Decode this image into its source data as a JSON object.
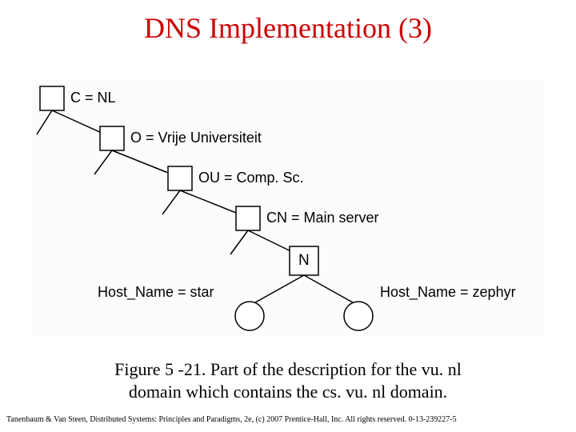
{
  "title": "DNS Implementation (3)",
  "diagram": {
    "nodes": {
      "c": {
        "label": "C = NL"
      },
      "o": {
        "label": "O = Vrije Universiteit"
      },
      "ou": {
        "label": "OU = Comp. Sc."
      },
      "cn": {
        "label": "CN = Main server"
      },
      "n": {
        "label": "N"
      }
    },
    "leaves": {
      "star": {
        "label": "Host_Name = star"
      },
      "zephyr": {
        "label": "Host_Name = zephyr"
      }
    }
  },
  "caption_line1": "Figure 5 -21. Part of the description for the vu. nl",
  "caption_line2": "domain which contains the cs. vu. nl domain.",
  "footer": "Tanenbaum & Van Steen, Distributed Systems: Principles and Paradigms, 2e, (c) 2007 Prentice-Hall, Inc. All rights reserved. 0-13-239227-5"
}
